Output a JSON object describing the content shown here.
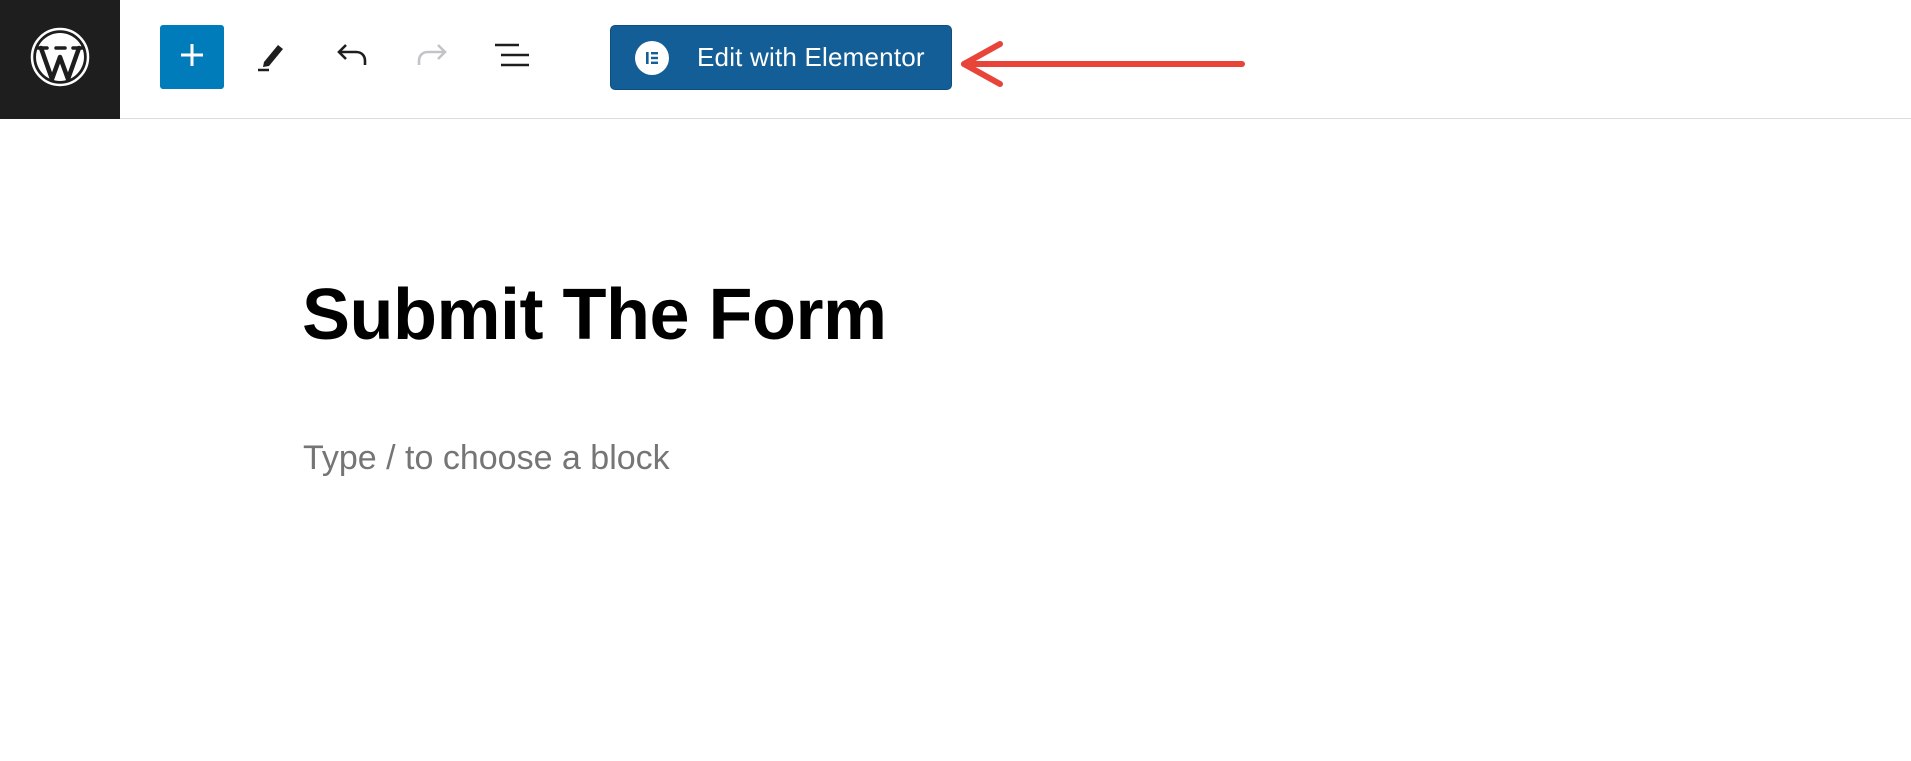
{
  "toolbar": {
    "logo_icon": "wordpress-logo-icon",
    "add_block_icon": "plus-icon",
    "tools_icon": "pencil-icon",
    "undo_icon": "undo-icon",
    "redo_icon": "redo-icon",
    "document_overview_icon": "list-view-icon",
    "elementor_button": {
      "label": "Edit with Elementor",
      "icon": "elementor-icon",
      "color": "#135e96"
    },
    "colors": {
      "logo_bg": "#1e1e1e",
      "add_block_bg": "#007cba",
      "redo_disabled": "#c3c4c7"
    }
  },
  "annotation": {
    "icon": "red-arrow-icon",
    "color": "#e9443a"
  },
  "editor": {
    "post_title": "Submit The Form",
    "block_placeholder": "Type / to choose a block"
  }
}
